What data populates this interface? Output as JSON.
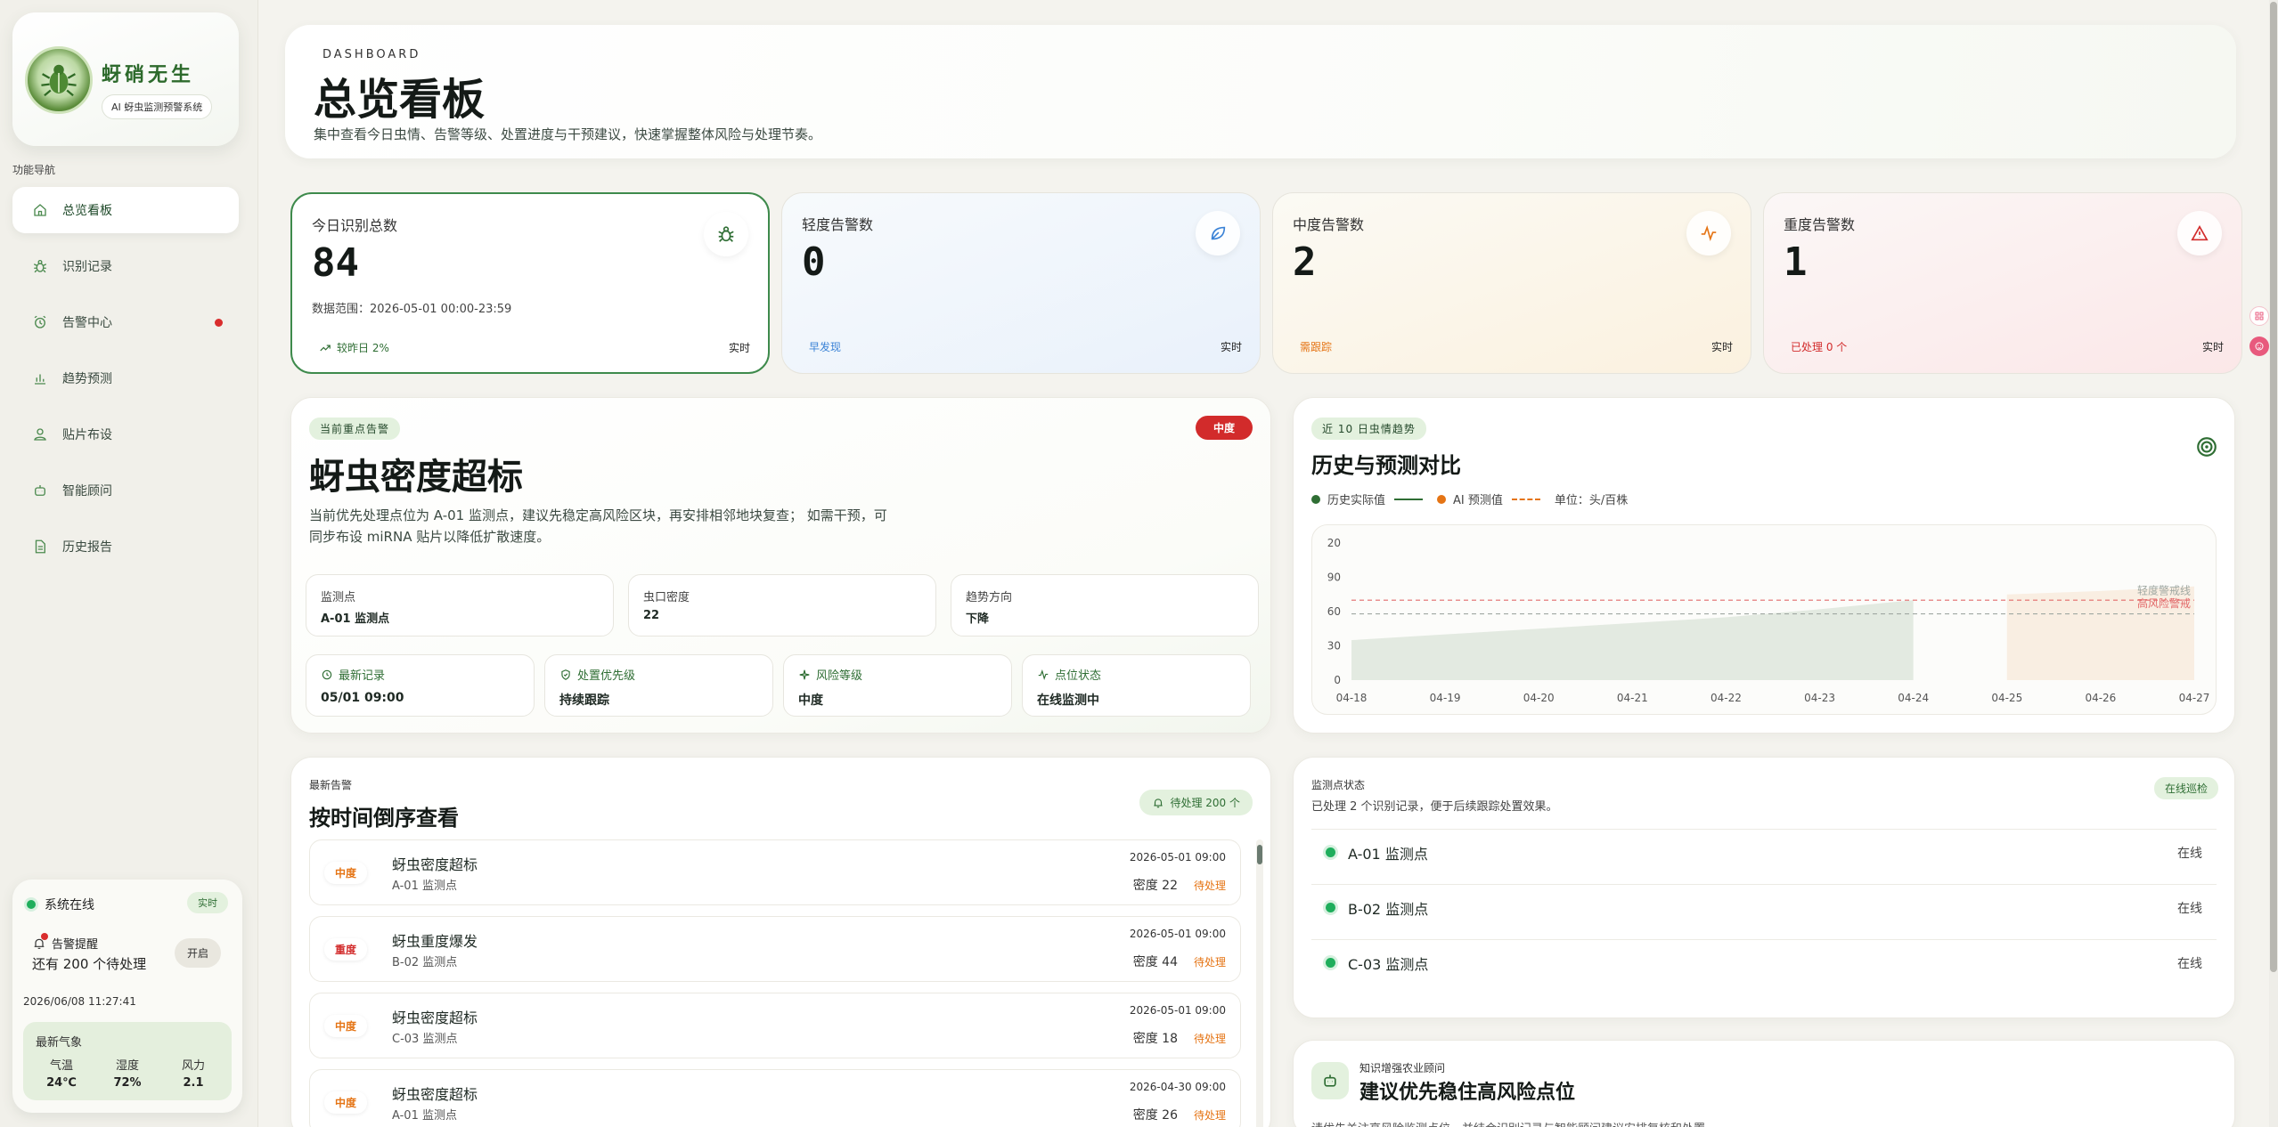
{
  "brand": {
    "name": "蚜硝无生",
    "subtitle": "AI 蚜虫监测预警系统"
  },
  "nav": {
    "title": "功能导航",
    "items": [
      {
        "label": "总览看板",
        "icon": "home-icon",
        "active": true
      },
      {
        "label": "识别记录",
        "icon": "bug-icon"
      },
      {
        "label": "告警中心",
        "icon": "alarm-icon",
        "badge": true
      },
      {
        "label": "趋势预测",
        "icon": "bar-chart-icon"
      },
      {
        "label": "贴片布设",
        "icon": "user-pin-icon"
      },
      {
        "label": "智能顾问",
        "icon": "robot-icon"
      },
      {
        "label": "历史报告",
        "icon": "document-icon"
      }
    ]
  },
  "system": {
    "status": "系统在线",
    "live": "实时",
    "alert_title": "告警提醒",
    "alert_detail": "还有 200 个待处理",
    "toggle_label": "开启",
    "datetime": "2026/06/08 11:27:41",
    "weather_title": "最新气象",
    "weather": [
      {
        "label": "气温",
        "value": "24℃"
      },
      {
        "label": "湿度",
        "value": "72%"
      },
      {
        "label": "风力",
        "value": "2.1"
      }
    ]
  },
  "header": {
    "kicker": "DASHBOARD",
    "title": "总览看板",
    "description": "集中查看今日虫情、告警等级、处置进度与干预建议，快速掌握整体风险与处理节奏。"
  },
  "stats": [
    {
      "label": "今日识别总数",
      "value": "84",
      "range": "数据范围：2026-05-01 00:00-23:59",
      "foot": "较昨日 2%",
      "live": "实时",
      "icon": "bug-icon",
      "color": "#2f6e34"
    },
    {
      "label": "轻度告警数",
      "value": "0",
      "range": "",
      "foot": "早发现",
      "live": "实时",
      "icon": "leaf-icon",
      "color": "#3a82d6"
    },
    {
      "label": "中度告警数",
      "value": "2",
      "range": "",
      "foot": "需跟踪",
      "live": "实时",
      "icon": "pulse-icon",
      "color": "#e57414"
    },
    {
      "label": "重度告警数",
      "value": "1",
      "range": "",
      "foot": "已处理 0 个",
      "live": "实时",
      "icon": "warning-icon",
      "color": "#d22b2b"
    }
  ],
  "focus": {
    "pill": "当前重点告警",
    "level": "中度",
    "title": "蚜虫密度超标",
    "description": "当前优先处理点位为 A-01 监测点，建议先稳定高风险区块，再安排相邻地块复查； 如需干预，可同步布设 miRNA 贴片以降低扩散速度。",
    "kvs": [
      {
        "label": "监测点",
        "value": "A-01 监测点"
      },
      {
        "label": "虫口密度",
        "value": "22"
      },
      {
        "label": "趋势方向",
        "value": "下降"
      }
    ],
    "chips": [
      {
        "label": "最新记录",
        "value": "05/01 09:00",
        "icon": "clock-icon"
      },
      {
        "label": "处置优先级",
        "value": "持续跟踪",
        "icon": "shield-check-icon"
      },
      {
        "label": "风险等级",
        "value": "中度",
        "icon": "sparkle-icon"
      },
      {
        "label": "点位状态",
        "value": "在线监测中",
        "icon": "pulse-icon"
      }
    ]
  },
  "trend": {
    "pill": "近 10 日虫情趋势",
    "title": "历史与预测对比",
    "legend_actual": "历史实际值",
    "legend_pred": "AI 预测值",
    "unit": "单位：头/百株",
    "line_labels": [
      "高风险警戒",
      "轻度警戒线"
    ]
  },
  "chart_data": {
    "type": "area",
    "x": [
      "04-18",
      "04-19",
      "04-20",
      "04-21",
      "04-22",
      "04-23",
      "04-24",
      "04-25",
      "04-26",
      "04-27"
    ],
    "y_ticks": [
      "20",
      "90",
      "60",
      "30",
      "0"
    ],
    "series": [
      {
        "name": "历史实际值",
        "values": [
          35,
          40,
          45,
          50,
          55,
          62,
          70,
          null,
          null,
          null
        ],
        "color": "#2f6e34"
      },
      {
        "name": "AI 预测值",
        "values": [
          null,
          null,
          null,
          null,
          null,
          null,
          null,
          75,
          78,
          82
        ],
        "color": "#e57414"
      }
    ],
    "thresholds": [
      {
        "label": "高风险警戒",
        "value": 70,
        "color": "#e26a6a"
      },
      {
        "label": "轻度警戒线",
        "value": 58,
        "color": "#a0a8a2"
      }
    ],
    "ylim": [
      0,
      120
    ],
    "grid": false,
    "legend": "top-left"
  },
  "alerts": {
    "kicker": "最新告警",
    "title": "按时间倒序查看",
    "badge": "待处理 200 个",
    "items": [
      {
        "level": "中度",
        "level_color": "#e57414",
        "name": "蚜虫密度超标",
        "site": "A-01 监测点",
        "time": "2026-05-01 09:00",
        "density": "密度 22",
        "status": "待处理"
      },
      {
        "level": "重度",
        "level_color": "#d22b2b",
        "name": "蚜虫重度爆发",
        "site": "B-02 监测点",
        "time": "2026-05-01 09:00",
        "density": "密度 44",
        "status": "待处理"
      },
      {
        "level": "中度",
        "level_color": "#e57414",
        "name": "蚜虫密度超标",
        "site": "C-03 监测点",
        "time": "2026-05-01 09:00",
        "density": "密度 18",
        "status": "待处理"
      },
      {
        "level": "中度",
        "level_color": "#e57414",
        "name": "蚜虫密度超标",
        "site": "A-01 监测点",
        "time": "2026-04-30 09:00",
        "density": "密度 26",
        "status": "待处理"
      }
    ]
  },
  "sites": {
    "kicker": "监测点状态",
    "description": "已处理 2 个识别记录，便于后续跟踪处置效果。",
    "badge": "在线巡检",
    "items": [
      {
        "name": "A-01 监测点",
        "status": "在线"
      },
      {
        "name": "B-02 监测点",
        "status": "在线"
      },
      {
        "name": "C-03 监测点",
        "status": "在线"
      }
    ]
  },
  "advice": {
    "kicker": "知识增强农业顾问",
    "title": "建议优先稳住高风险点位",
    "description": "请优先关注高风险监测点位，并结合识别记录与智能顾问建议安排复核和处置。"
  }
}
